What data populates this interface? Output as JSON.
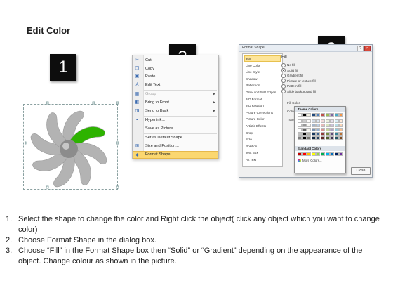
{
  "title": "Edit Color",
  "steps": [
    {
      "number": "1"
    },
    {
      "number": "2"
    },
    {
      "number": "3"
    }
  ],
  "context_menu": {
    "items": [
      {
        "label": "Cut",
        "icon": "scissors-icon",
        "disabled": false,
        "submenu": false,
        "highlight": false
      },
      {
        "label": "Copy",
        "icon": "copy-icon",
        "disabled": false,
        "submenu": false,
        "highlight": false
      },
      {
        "label": "Paste",
        "icon": "paste-icon",
        "disabled": false,
        "submenu": false,
        "highlight": false
      },
      {
        "label": "Edit Text",
        "icon": "edit-text-icon",
        "disabled": false,
        "submenu": false,
        "highlight": false
      },
      {
        "label": "Group",
        "icon": "group-icon",
        "disabled": true,
        "submenu": true,
        "highlight": false
      },
      {
        "label": "Bring to Front",
        "icon": "bring-front-icon",
        "disabled": false,
        "submenu": true,
        "highlight": false
      },
      {
        "label": "Send to Back",
        "icon": "send-back-icon",
        "disabled": false,
        "submenu": true,
        "highlight": false
      },
      {
        "label": "Hyperlink...",
        "icon": "hyperlink-icon",
        "disabled": false,
        "submenu": false,
        "highlight": false
      },
      {
        "label": "Save as Picture...",
        "icon": "",
        "disabled": false,
        "submenu": false,
        "highlight": false
      },
      {
        "label": "Set as Default Shape",
        "icon": "",
        "disabled": false,
        "submenu": false,
        "highlight": false
      },
      {
        "label": "Size and Position...",
        "icon": "size-position-icon",
        "disabled": false,
        "submenu": false,
        "highlight": false
      },
      {
        "label": "Format Shape...",
        "icon": "format-shape-icon",
        "disabled": false,
        "submenu": false,
        "highlight": true
      }
    ]
  },
  "dialog": {
    "title": "Format Shape",
    "categories": [
      "Fill",
      "Line Color",
      "Line Style",
      "Shadow",
      "Reflection",
      "Glow and Soft Edges",
      "3-D Format",
      "3-D Rotation",
      "Picture Corrections",
      "Picture Color",
      "Artistic Effects",
      "Crop",
      "Size",
      "Position",
      "Text Box",
      "Alt Text"
    ],
    "selected_category": "Fill",
    "fill_heading": "Fill",
    "fill_options": [
      {
        "label": "No fill",
        "selected": false
      },
      {
        "label": "Solid fill",
        "selected": true
      },
      {
        "label": "Gradient fill",
        "selected": false
      },
      {
        "label": "Picture or texture fill",
        "selected": false
      },
      {
        "label": "Pattern fill",
        "selected": false
      },
      {
        "label": "Slide background fill",
        "selected": false
      }
    ],
    "fill_color_heading": "Fill Color",
    "color_label": "Color:",
    "transparency_label": "Transpa",
    "close_label": "Close"
  },
  "palette": {
    "theme_heading": "Theme Colors",
    "standard_heading": "Standard Colors",
    "more_colors": "More Colors...",
    "theme_top": [
      "#ffffff",
      "#000000",
      "#eeece1",
      "#1f497d",
      "#4f81bd",
      "#c0504d",
      "#9bbb59",
      "#8064a2",
      "#4bacc6",
      "#f79646"
    ],
    "standard": [
      "#c00000",
      "#ff0000",
      "#ffc000",
      "#ffff00",
      "#92d050",
      "#00b050",
      "#00b0f0",
      "#0070c0",
      "#002060",
      "#7030a0"
    ]
  },
  "pinwheel": {
    "blade_color": "#b3b3b3",
    "highlight_color": "#2db300",
    "hub_color": "#8c8c8c"
  },
  "instructions": [
    {
      "num": "1.",
      "text": "Select the shape to change the color and Right click the object( click any object which you want to change color)"
    },
    {
      "num": "2.",
      "text": "Choose Format Shape in the dialog box."
    },
    {
      "num": "3.",
      "text": "Choose “Fill” in the Format Shape box then “Solid” or “Gradient” depending on the appearance of the object. Change colour as shown in the picture."
    }
  ]
}
